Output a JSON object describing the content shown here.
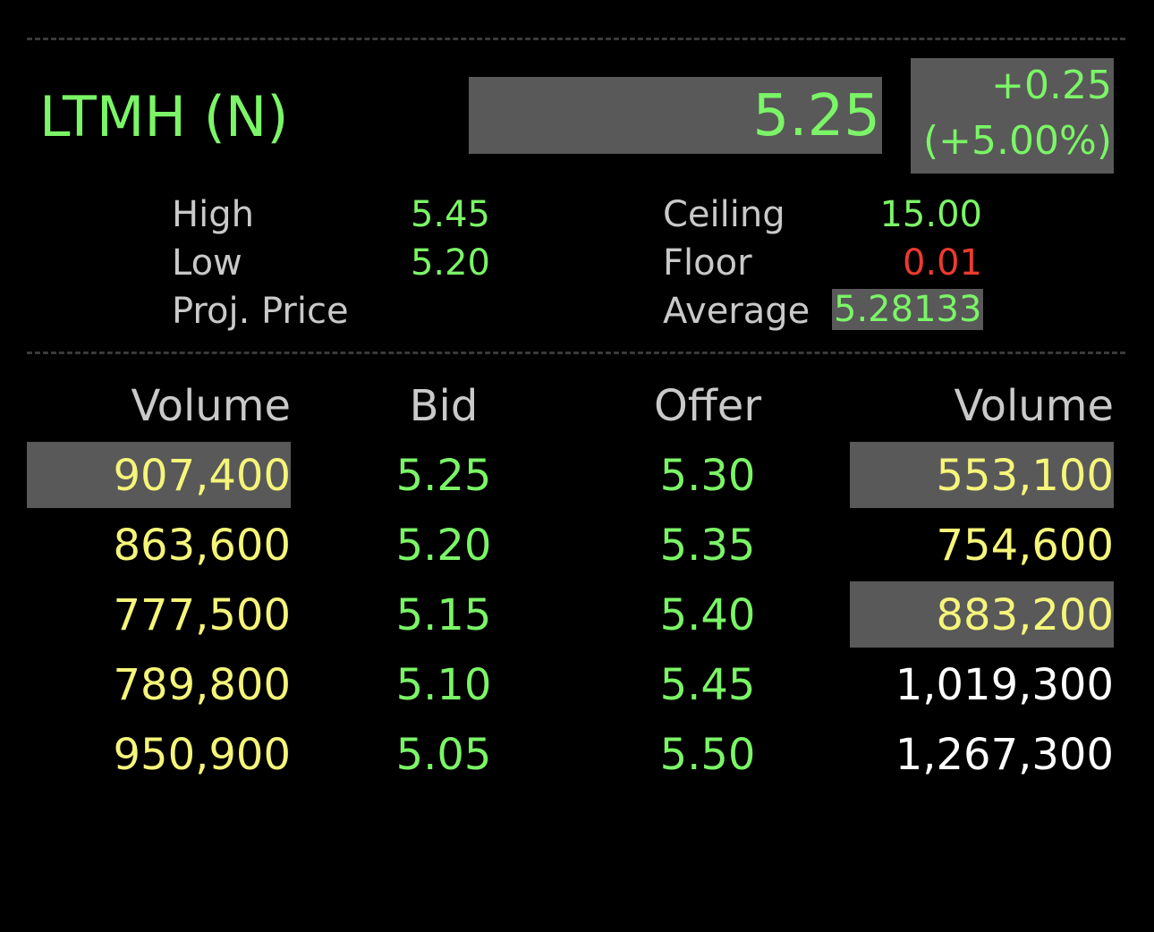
{
  "colors": {
    "green": "#7bf567",
    "yellow": "#f5f57a",
    "red": "#ec3a2f",
    "label_gray": "#c9c9c9",
    "highlight_bg": "#595959",
    "background": "#000000"
  },
  "header": {
    "ticker": "LTMH (N)",
    "last_price": "5.25",
    "change": "+0.25",
    "change_pct": "(+5.00%)"
  },
  "stats": {
    "high": {
      "label": "High",
      "value": "5.45"
    },
    "low": {
      "label": "Low",
      "value": "5.20"
    },
    "proj_price": {
      "label": "Proj. Price",
      "value": ""
    },
    "ceiling": {
      "label": "Ceiling",
      "value": "15.00"
    },
    "floor": {
      "label": "Floor",
      "value": "0.01"
    },
    "average": {
      "label": "Average",
      "value": "5.28133"
    }
  },
  "order_book": {
    "headers": {
      "bid_volume": "Volume",
      "bid": "Bid",
      "offer": "Offer",
      "offer_volume": "Volume"
    },
    "rows": [
      {
        "bid_volume": "907,400",
        "bid": "5.25",
        "offer": "5.30",
        "offer_volume": "553,100"
      },
      {
        "bid_volume": "863,600",
        "bid": "5.20",
        "offer": "5.35",
        "offer_volume": "754,600"
      },
      {
        "bid_volume": "777,500",
        "bid": "5.15",
        "offer": "5.40",
        "offer_volume": "883,200"
      },
      {
        "bid_volume": "789,800",
        "bid": "5.10",
        "offer": "5.45",
        "offer_volume": "1,019,300"
      },
      {
        "bid_volume": "950,900",
        "bid": "5.05",
        "offer": "5.50",
        "offer_volume": "1,267,300"
      }
    ]
  }
}
